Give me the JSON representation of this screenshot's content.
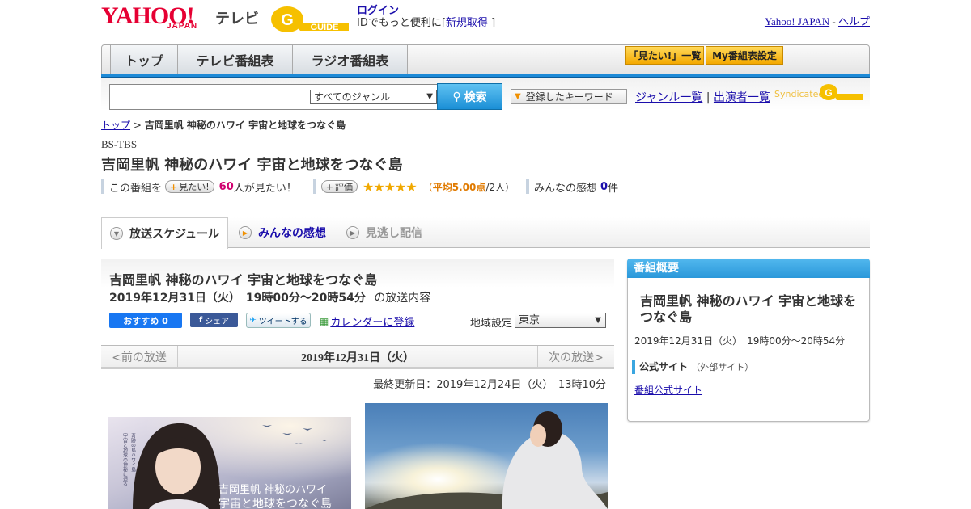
{
  "header": {
    "yahoo_logo": "YAHOO!",
    "japan_logo": "JAPAN",
    "tv_label": "テレビ",
    "gguide_logo": "G-GUIDE",
    "login": "ログイン",
    "id_text_prefix": "IDでもっと便利に[",
    "register": "新規取得",
    "id_text_suffix": "]",
    "yahoo_japan_link": "Yahoo! JAPAN",
    "separator": "-",
    "help_link": "ヘルプ"
  },
  "nav": {
    "tabs": [
      "トップ",
      "テレビ番組表",
      "ラジオ番組表"
    ],
    "want_list": "「見たい!」一覧",
    "my_schedule": "My番組表設定"
  },
  "search": {
    "genre_selected": "すべてのジャンル",
    "search_button": "検索",
    "registered_keyword": "登録したキーワード",
    "genre_list": "ジャンル一覧",
    "pipe": "|",
    "performer_list": "出演者一覧",
    "syndicated": "Syndicated"
  },
  "breadcrumb": {
    "top": "トップ",
    "sep": ">",
    "current": "吉岡里帆 神秘のハワイ 宇宙と地球をつなぐ島"
  },
  "program": {
    "channel": "BS-TBS",
    "title": "吉岡里帆 神秘のハワイ 宇宙と地球をつなぐ島",
    "want_prefix": "この番組を",
    "want_button": "見たい!",
    "want_count": "60",
    "want_suffix": "人が見たい！",
    "rating_button": "評価",
    "stars": "★★★★★",
    "rating_prefix": "（",
    "rating_avg": "平均5.00点",
    "rating_suffix": "/2人）",
    "impressions_prefix": "みんなの感想",
    "impressions_count": "0",
    "impressions_suffix": "件"
  },
  "tabs": {
    "schedule": "放送スケジュール",
    "impressions": "みんなの感想",
    "missed": "見逃し配信"
  },
  "broadcast": {
    "title": "吉岡里帆 神秘のハワイ 宇宙と地球をつなぐ島",
    "datetime": "2019年12月31日（火）　19時00分～20時54分",
    "content_suffix": "の放送内容",
    "fb_recommend": "おすすめ 0",
    "share": "シェア",
    "tweet": "ツイートする",
    "calendar": "カレンダーに登録",
    "region_label": "地域設定",
    "region_value": "東京",
    "prev": "<前の放送",
    "current_date": "2019年12月31日（火）",
    "next": "次の放送>",
    "updated": "最終更新日：2019年12月24日（火）　13時10分",
    "image1_text_a": "吉岡里帆 神秘のハワイ",
    "image1_text_b": "宇宙と地球をつなぐ島",
    "image1_side_a": "宇宙と地球の神秘に迫る",
    "image1_side_b": "奇跡の島ハワイ島"
  },
  "sidebar": {
    "header": "番組概要",
    "title": "吉岡里帆 神秘のハワイ 宇宙と地球をつなぐ島",
    "datetime": "2019年12月31日（火）　19時00分～20時54分",
    "official_site": "公式サイト",
    "external": "（外部サイト）",
    "official_link": "番組公式サイト"
  },
  "colors": {
    "accent_blue": "#1d8ad7",
    "yahoo_red": "#e60033",
    "star_orange": "#f0a800"
  }
}
